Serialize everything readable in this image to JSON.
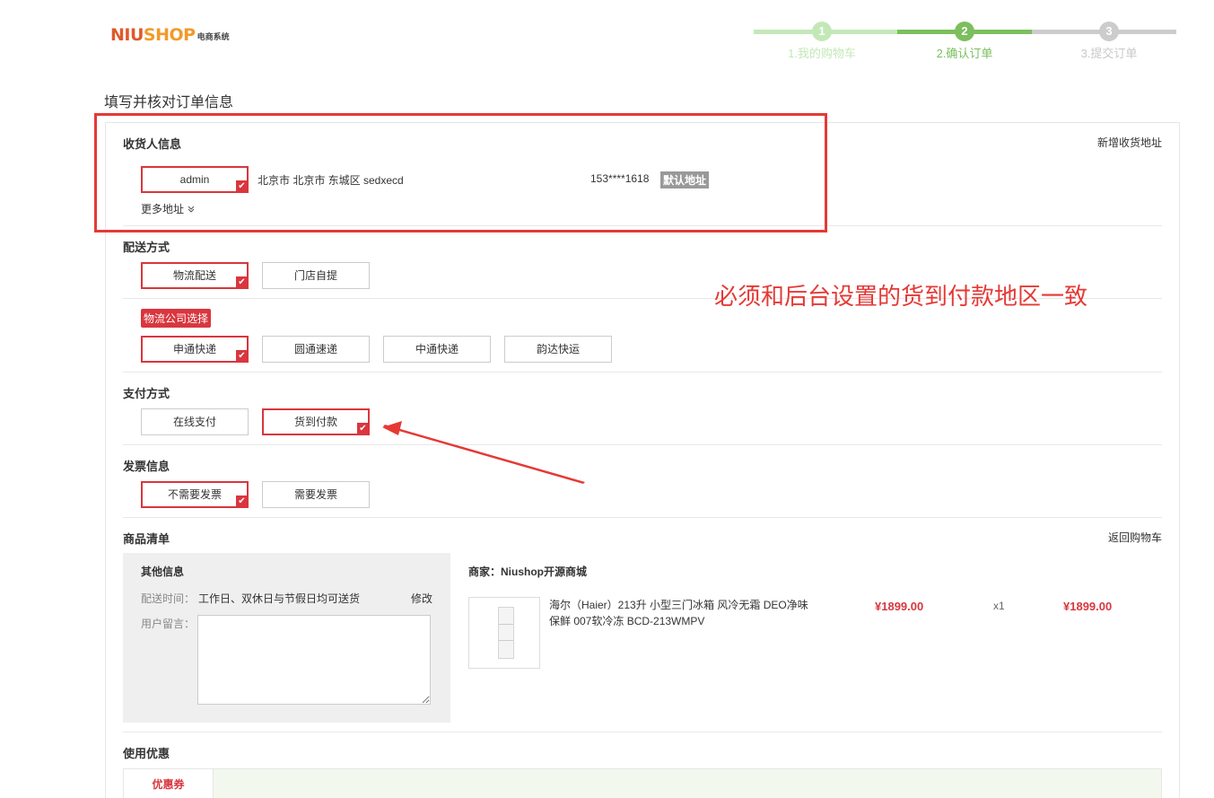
{
  "logo": {
    "brand_a": "NIU",
    "brand_b": "SHOP",
    "sub": "电商系统"
  },
  "steps": [
    {
      "num": "1",
      "label": "1.我的购物车",
      "state": "done"
    },
    {
      "num": "2",
      "label": "2.确认订单",
      "state": "current"
    },
    {
      "num": "3",
      "label": "3.提交订单",
      "state": "todo"
    }
  ],
  "colors": {
    "accent_red": "#d9363e",
    "step_done": "#c3e8b7",
    "step_current": "#7bbf5e",
    "step_todo": "#cccccc",
    "annotation": "#e53935"
  },
  "page_title": "填写并核对订单信息",
  "consignee": {
    "title": "收货人信息",
    "add_link": "新增收货地址",
    "name": "admin",
    "address": "北京市 北京市 东城区 sedxecd",
    "phone": "153****1618",
    "default_badge": "默认地址",
    "more": "更多地址",
    "more_icon": "chevron-down-double"
  },
  "delivery": {
    "title": "配送方式",
    "options": [
      "物流配送",
      "门店自提"
    ],
    "selected": 0,
    "company_tag": "物流公司选择",
    "companies": [
      "申通快递",
      "圆通速递",
      "中通快递",
      "韵达快运"
    ],
    "company_selected": 0
  },
  "annotation": "必须和后台设置的货到付款地区一致",
  "payment": {
    "title": "支付方式",
    "options": [
      "在线支付",
      "货到付款"
    ],
    "selected": 1
  },
  "invoice": {
    "title": "发票信息",
    "options": [
      "不需要发票",
      "需要发票"
    ],
    "selected": 0
  },
  "goods": {
    "title": "商品清单",
    "back_link": "返回购物车",
    "other_info_title": "其他信息",
    "delivery_time_label": "配送时间：",
    "delivery_time_value": "工作日、双休日与节假日均可送货",
    "edit": "修改",
    "message_label": "用户留言：",
    "merchant": "商家：Niushop开源商城",
    "product_name": "海尔（Haier）213升 小型三门冰箱 风冷无霜 DEO净味保鲜 007软冷冻 BCD-213WMPV",
    "unit_price": "¥1899.00",
    "quantity": "x1",
    "subtotal": "¥1899.00"
  },
  "coupon": {
    "title": "使用优惠",
    "tab": "优惠券"
  },
  "check_icon": "✔"
}
